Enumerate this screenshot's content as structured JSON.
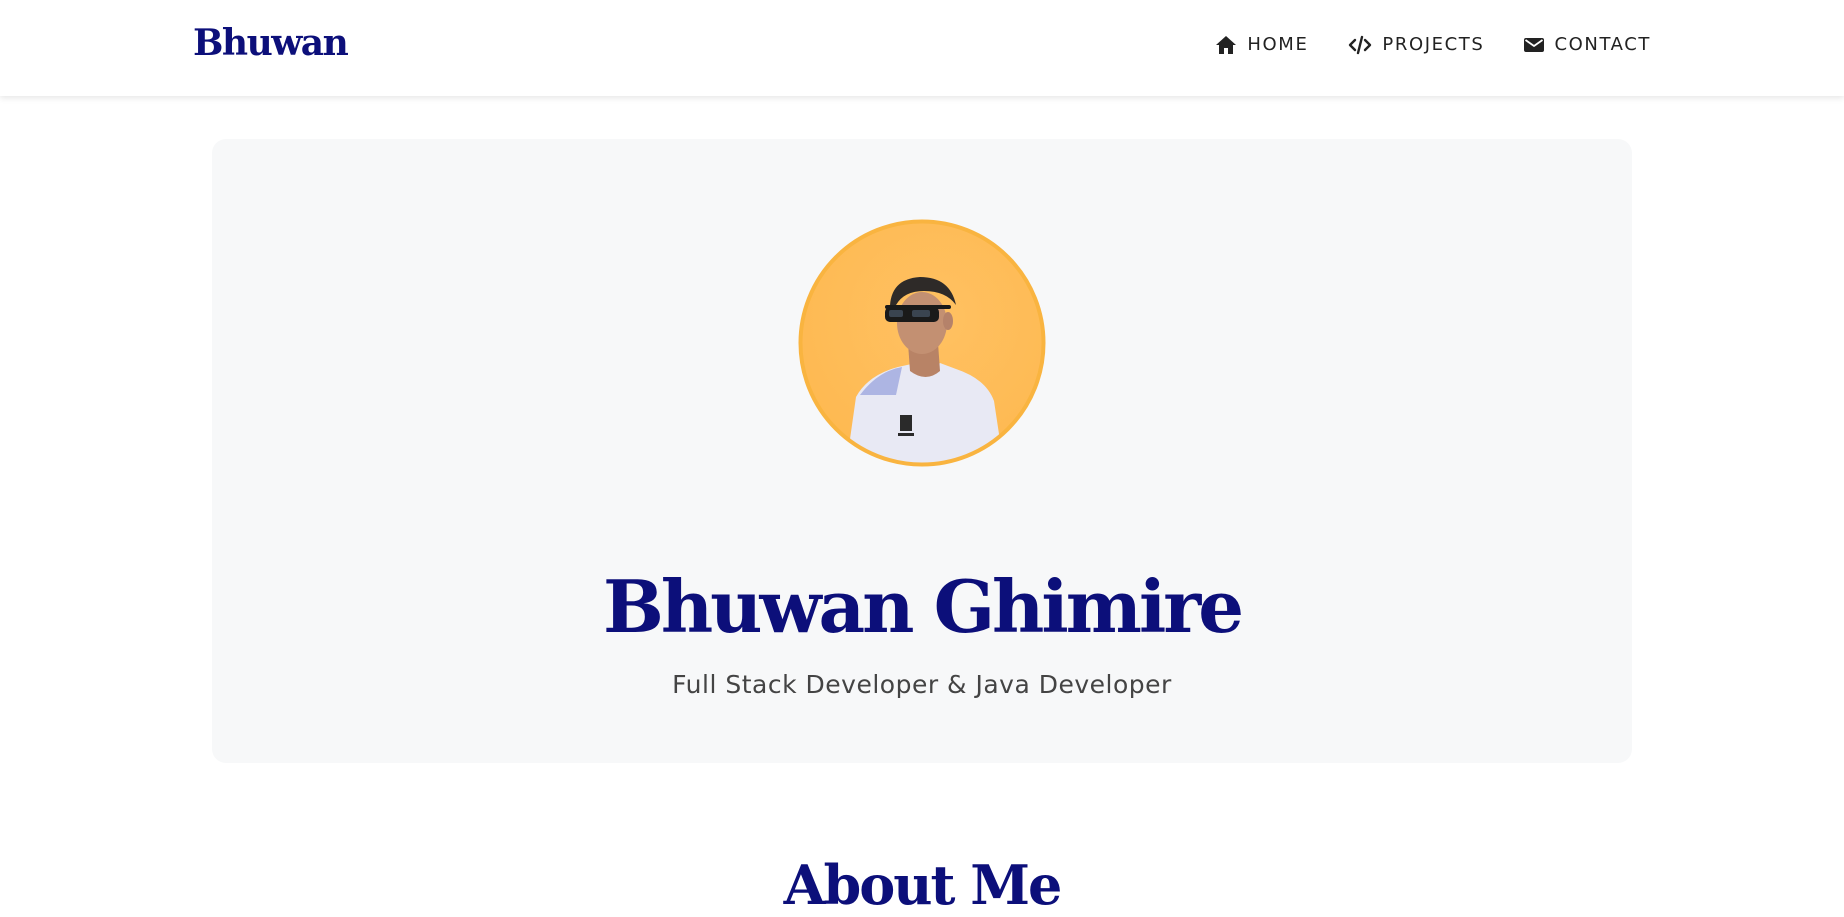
{
  "header": {
    "brand": "Bhuwan",
    "nav": [
      {
        "label": "HOME",
        "icon": "home-icon"
      },
      {
        "label": "PROJECTS",
        "icon": "code-icon"
      },
      {
        "label": "CONTACT",
        "icon": "envelope-icon"
      }
    ]
  },
  "hero": {
    "name": "Bhuwan Ghimire",
    "subtitle": "Full Stack Developer & Java Developer",
    "avatar_icon": "profile-photo"
  },
  "about": {
    "heading": "About Me"
  },
  "colors": {
    "brand_navy": "#0c0f7a",
    "hero_background": "#f7f8f9",
    "avatar_ring": "#f9b440",
    "nav_text": "#222222"
  }
}
